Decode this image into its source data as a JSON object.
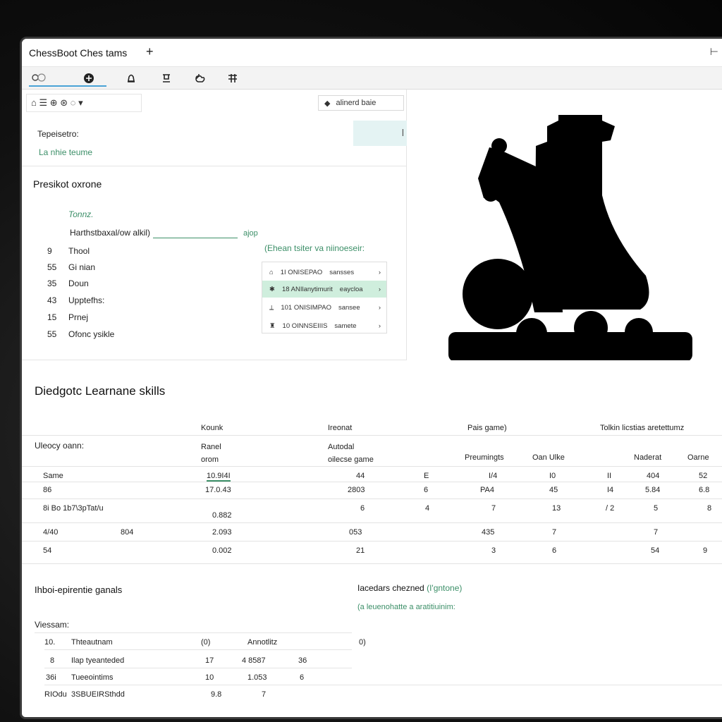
{
  "app": {
    "tab_title": "ChessBoot Ches tams",
    "new_tab_symbol": "+",
    "window_control": "⊢"
  },
  "toolbar": {
    "icons": [
      "tabs-icon",
      "chess-king-icon",
      "bell-icon",
      "save-icon",
      "hand-icon",
      "grid-icon"
    ]
  },
  "left_panel": {
    "format_icons": "⌂ ☰ ⊕ ⊛ ◌ ▾",
    "dropdown_label": "alinerd baie",
    "label_top": "Tepeisetro:",
    "label_sub": "La nhie teume",
    "teal_box_value": "l",
    "section_title": "Presikot oxrone",
    "italic_note": "Tonnz.",
    "input_label": "Harthstbaxal/ow alkil)",
    "input_suffix": "ajop",
    "hint_text": "(Ehean tsiter va niinoeseir:",
    "list": [
      {
        "num": "9",
        "label": "Thool"
      },
      {
        "num": "55",
        "label": "Gi nian"
      },
      {
        "num": "35",
        "label": "Doun"
      },
      {
        "num": "43",
        "label": "Upptefhs:"
      },
      {
        "num": "15",
        "label": "Prnej"
      },
      {
        "num": "55",
        "label": "Ofonc ysikle"
      }
    ],
    "card_rows": [
      {
        "icon": "⌂",
        "text": "1I ONISEPAO",
        "extra": "sansses"
      },
      {
        "icon": "✱",
        "text": "18 ANIlanytimurit",
        "extra": "eaycloa"
      },
      {
        "icon": "⟂",
        "text": "101 ONISIMPAO",
        "extra": "sansee"
      },
      {
        "icon": "♜",
        "text": "10 OINNSEIIIS",
        "extra": "samete"
      }
    ]
  },
  "skills": {
    "title": "Diedgotc Learnane skills",
    "group_headers": [
      "Kounk",
      "Ireonat",
      "Pais game)",
      "Tolkin licstias aretettumz"
    ],
    "row_label_header": "Uleocy oann:",
    "sub_headers": [
      "Ranel\norom",
      "Autodal\noilecse game",
      "Preumingts",
      "Oan Ulke",
      "Naderat",
      "Oarne"
    ],
    "rows": [
      [
        "Same",
        "10.9I4I",
        "44",
        "E",
        "I/4",
        "I0",
        "II",
        "404",
        "52"
      ],
      [
        "86",
        "17.0.43",
        "2803",
        "6",
        "PA4",
        "45",
        "I4",
        "5.84",
        "6.8"
      ],
      [
        "8i Bo 1b7\\3pTat/u",
        "0.882",
        "6",
        "4",
        "7",
        "13",
        "/ 2",
        "5",
        "8"
      ],
      [
        "4/40",
        "804",
        "2.093",
        "053",
        "435",
        "7",
        "7",
        "",
        ""
      ],
      [
        "54",
        "",
        "0.002",
        "21",
        "3",
        "6",
        "54",
        "9",
        ""
      ]
    ]
  },
  "goals": {
    "title": "Ihboi-epirentie ganals",
    "sub_label": "Viessam:",
    "rows": [
      [
        "10.",
        "Thteautnam",
        "(0)",
        "Annotlitz"
      ],
      [
        "8",
        "Ilap tyeanteded",
        "17",
        "4 8587",
        "36"
      ],
      [
        "36i",
        "Tueeointims",
        "10",
        "1.053",
        "6"
      ],
      [
        "RIOdu",
        "3SBUEIRSthdd",
        "9.8",
        "7"
      ]
    ]
  },
  "opponents": {
    "title": "Iacedars chezned",
    "title_suffix": "(I'gntone)",
    "subtitle": "(a leuenohatte a aratitiuinim:",
    "value": "0)"
  },
  "colors": {
    "accent_green": "#3c8f68",
    "teal_box": "#e4f3f3",
    "selected_row": "#cfeedd",
    "tab_underline": "#4aa3d6"
  }
}
